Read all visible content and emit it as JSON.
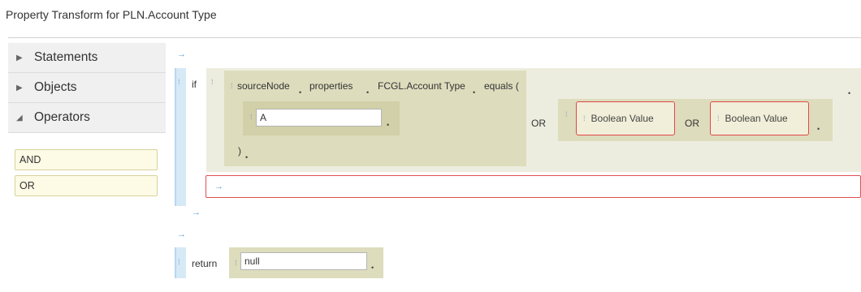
{
  "page_title": "Property Transform for PLN.Account Type",
  "sidebar": {
    "items": [
      {
        "label": "Statements",
        "expanded": false
      },
      {
        "label": "Objects",
        "expanded": false
      },
      {
        "label": "Operators",
        "expanded": true
      }
    ],
    "operators": [
      "AND",
      "OR"
    ]
  },
  "editor": {
    "arrow_glyph": "→",
    "grip_glyph": "⁞",
    "dot_glyph": "•",
    "if_keyword": "if",
    "condition": {
      "tokens": [
        "sourceNode",
        "properties",
        "FCGL.Account Type",
        "equals ("
      ],
      "value": "A",
      "close_paren": ")"
    },
    "or_label": "OR",
    "bool_placeholder": "Boolean Value",
    "return_keyword": "return",
    "return_value": "null"
  }
}
